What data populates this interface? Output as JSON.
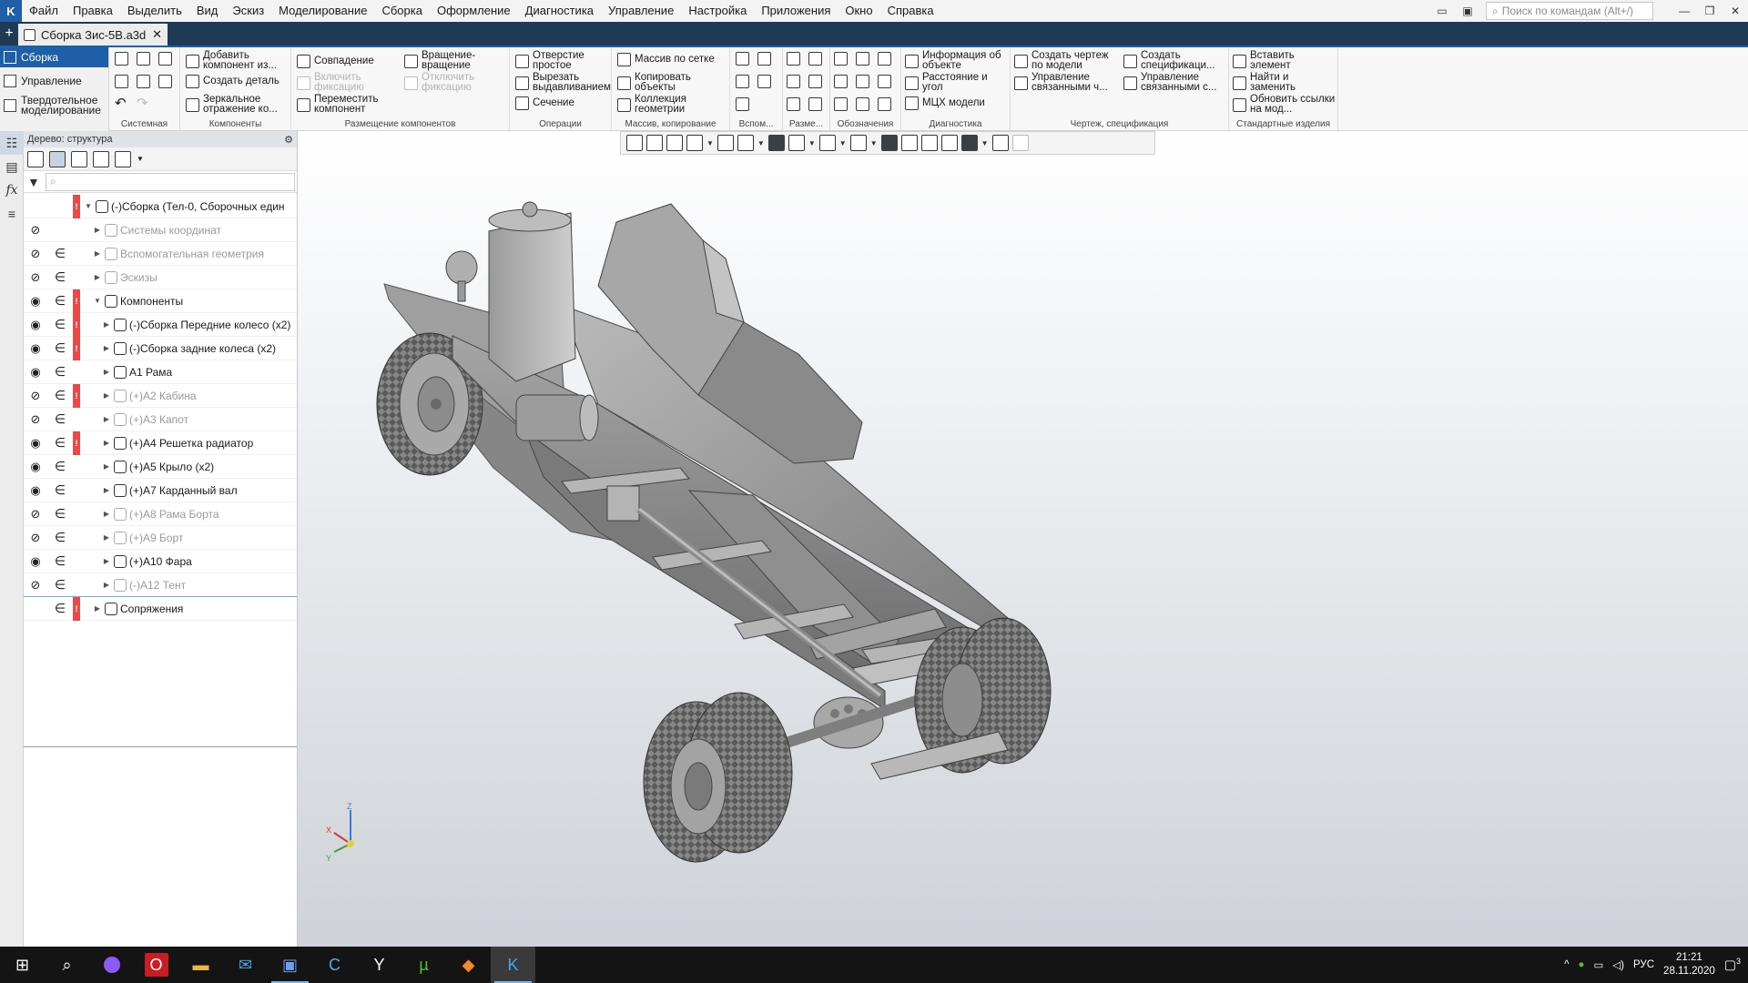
{
  "menu": {
    "items": [
      "Файл",
      "Правка",
      "Выделить",
      "Вид",
      "Эскиз",
      "Моделирование",
      "Сборка",
      "Оформление",
      "Диагностика",
      "Управление",
      "Настройка",
      "Приложения",
      "Окно",
      "Справка"
    ],
    "search_placeholder": "Поиск по командам (Alt+/)"
  },
  "tab": {
    "title": "Сборка Зис-5В.a3d"
  },
  "modes": {
    "items": [
      "Сборка",
      "Управление",
      "Твердотельное моделирование"
    ]
  },
  "ribbon": {
    "groups": {
      "system": "Системная",
      "components": "Компоненты",
      "placement": "Размещение компонентов",
      "operations": "Операции",
      "array": "Массив, копирование",
      "aux": "Вспом...",
      "size": "Разме...",
      "notation": "Обозначения",
      "diagnostics": "Диагностика",
      "drawing": "Чертеж, спецификация",
      "standard": "Стандартные изделия"
    },
    "buttons": {
      "add_component": "Добавить компонент из...",
      "create_part": "Создать деталь",
      "mirror": "Зеркальное отражение ко...",
      "coincidence": "Совпадение",
      "enable_fix": "Включить фиксацию",
      "move_component": "Переместить компонент",
      "rotate": "Вращение-вращение",
      "disable_fix": "Отключить фиксацию",
      "hole": "Отверстие простое",
      "cut_extrude": "Вырезать выдавливанием",
      "section": "Сечение",
      "grid_array": "Массив по сетке",
      "copy_objects": "Копировать объекты",
      "geometry_collection": "Коллекция геометрии",
      "object_info": "Информация об объекте",
      "distance_angle": "Расстояние и угол",
      "mass_props": "МЦХ модели",
      "create_drawing": "Создать чертеж по модели",
      "manage_linked": "Управление связанными ч...",
      "create_spec": "Создать спецификаци...",
      "manage_linked_spec": "Управление связанными с...",
      "insert_element": "Вставить элемент",
      "find_replace": "Найти и заменить",
      "update_links": "Обновить ссылки на мод..."
    }
  },
  "tree": {
    "header": "Дерево: структура",
    "rows": [
      {
        "label": "(-)Сборка (Тел-0, Сборочных един",
        "eye": "",
        "member": "",
        "warn": true,
        "dim": false,
        "indent": 0,
        "expanded": true
      },
      {
        "label": "Системы координат",
        "eye": "hidden",
        "member": "",
        "warn": false,
        "dim": true,
        "indent": 1,
        "expanded": false
      },
      {
        "label": "Вспомогательная геометрия",
        "eye": "hidden",
        "member": "∈",
        "warn": false,
        "dim": true,
        "indent": 1,
        "expanded": false
      },
      {
        "label": "Эскизы",
        "eye": "hidden",
        "member": "∈",
        "warn": false,
        "dim": true,
        "indent": 1,
        "expanded": false
      },
      {
        "label": "Компоненты",
        "eye": "visible",
        "member": "∈",
        "warn": true,
        "dim": false,
        "indent": 1,
        "expanded": true
      },
      {
        "label": "(-)Сборка Передние колесо (x2)",
        "eye": "visible",
        "member": "∈",
        "warn": true,
        "dim": false,
        "indent": 2,
        "expanded": false
      },
      {
        "label": "(-)Сборка задние колеса (x2)",
        "eye": "visible",
        "member": "∈",
        "warn": true,
        "dim": false,
        "indent": 2,
        "expanded": false
      },
      {
        "label": "А1 Рама",
        "eye": "visible",
        "member": "∈",
        "warn": false,
        "dim": false,
        "indent": 2,
        "expanded": false
      },
      {
        "label": "(+)А2 Кабина",
        "eye": "hidden",
        "member": "∈",
        "warn": true,
        "dim": true,
        "indent": 2,
        "expanded": false
      },
      {
        "label": "(+)А3 Капот",
        "eye": "hidden",
        "member": "∈",
        "warn": false,
        "dim": true,
        "indent": 2,
        "expanded": false
      },
      {
        "label": "(+)А4 Решетка радиатор",
        "eye": "visible",
        "member": "∈",
        "warn": true,
        "dim": false,
        "indent": 2,
        "expanded": false
      },
      {
        "label": "(+)А5 Крыло (x2)",
        "eye": "visible",
        "member": "∈",
        "warn": false,
        "dim": false,
        "indent": 2,
        "expanded": false
      },
      {
        "label": "(+)А7 Карданный вал",
        "eye": "visible",
        "member": "∈",
        "warn": false,
        "dim": false,
        "indent": 2,
        "expanded": false
      },
      {
        "label": "(+)А8 Рама Борта",
        "eye": "hidden",
        "member": "∈",
        "warn": false,
        "dim": true,
        "indent": 2,
        "expanded": false
      },
      {
        "label": "(+)А9 Борт",
        "eye": "hidden",
        "member": "∈",
        "warn": false,
        "dim": true,
        "indent": 2,
        "expanded": false
      },
      {
        "label": "(+)А10 Фара",
        "eye": "visible",
        "member": "∈",
        "warn": false,
        "dim": false,
        "indent": 2,
        "expanded": false
      },
      {
        "label": "(-)А12 Тент",
        "eye": "hidden",
        "member": "∈",
        "warn": false,
        "dim": true,
        "indent": 2,
        "expanded": false
      },
      {
        "label": "Сопряжения",
        "eye": "",
        "member": "∈",
        "warn": true,
        "dim": false,
        "indent": 1,
        "expanded": false
      }
    ]
  },
  "axes": {
    "x": "X",
    "y": "Y",
    "z": "Z"
  },
  "taskbar": {
    "language": "РУС",
    "time": "21:21",
    "date": "28.11.2020",
    "notifications": "3"
  },
  "colors": {
    "accent": "#1f5fa8",
    "warning": "#e84a4a",
    "tab_bg": "#1f3a55"
  }
}
